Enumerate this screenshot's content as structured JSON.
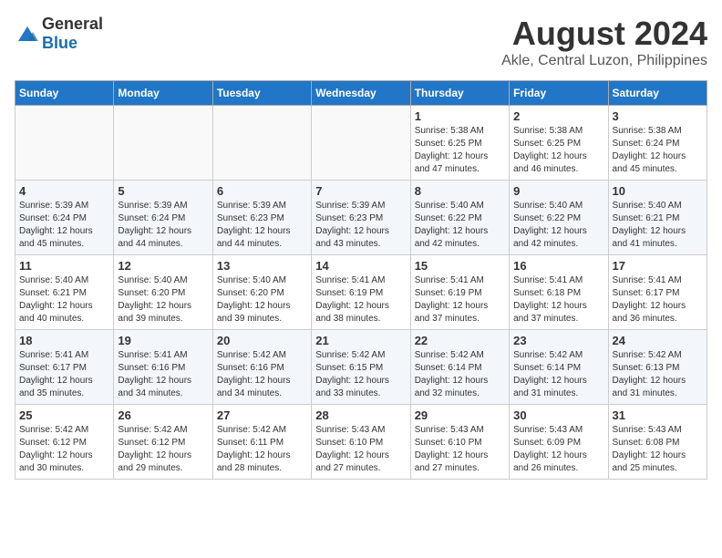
{
  "header": {
    "logo_general": "General",
    "logo_blue": "Blue",
    "month_year": "August 2024",
    "location": "Akle, Central Luzon, Philippines"
  },
  "days_of_week": [
    "Sunday",
    "Monday",
    "Tuesday",
    "Wednesday",
    "Thursday",
    "Friday",
    "Saturday"
  ],
  "weeks": [
    [
      {
        "day": "",
        "info": ""
      },
      {
        "day": "",
        "info": ""
      },
      {
        "day": "",
        "info": ""
      },
      {
        "day": "",
        "info": ""
      },
      {
        "day": "1",
        "info": "Sunrise: 5:38 AM\nSunset: 6:25 PM\nDaylight: 12 hours\nand 47 minutes."
      },
      {
        "day": "2",
        "info": "Sunrise: 5:38 AM\nSunset: 6:25 PM\nDaylight: 12 hours\nand 46 minutes."
      },
      {
        "day": "3",
        "info": "Sunrise: 5:38 AM\nSunset: 6:24 PM\nDaylight: 12 hours\nand 45 minutes."
      }
    ],
    [
      {
        "day": "4",
        "info": "Sunrise: 5:39 AM\nSunset: 6:24 PM\nDaylight: 12 hours\nand 45 minutes."
      },
      {
        "day": "5",
        "info": "Sunrise: 5:39 AM\nSunset: 6:24 PM\nDaylight: 12 hours\nand 44 minutes."
      },
      {
        "day": "6",
        "info": "Sunrise: 5:39 AM\nSunset: 6:23 PM\nDaylight: 12 hours\nand 44 minutes."
      },
      {
        "day": "7",
        "info": "Sunrise: 5:39 AM\nSunset: 6:23 PM\nDaylight: 12 hours\nand 43 minutes."
      },
      {
        "day": "8",
        "info": "Sunrise: 5:40 AM\nSunset: 6:22 PM\nDaylight: 12 hours\nand 42 minutes."
      },
      {
        "day": "9",
        "info": "Sunrise: 5:40 AM\nSunset: 6:22 PM\nDaylight: 12 hours\nand 42 minutes."
      },
      {
        "day": "10",
        "info": "Sunrise: 5:40 AM\nSunset: 6:21 PM\nDaylight: 12 hours\nand 41 minutes."
      }
    ],
    [
      {
        "day": "11",
        "info": "Sunrise: 5:40 AM\nSunset: 6:21 PM\nDaylight: 12 hours\nand 40 minutes."
      },
      {
        "day": "12",
        "info": "Sunrise: 5:40 AM\nSunset: 6:20 PM\nDaylight: 12 hours\nand 39 minutes."
      },
      {
        "day": "13",
        "info": "Sunrise: 5:40 AM\nSunset: 6:20 PM\nDaylight: 12 hours\nand 39 minutes."
      },
      {
        "day": "14",
        "info": "Sunrise: 5:41 AM\nSunset: 6:19 PM\nDaylight: 12 hours\nand 38 minutes."
      },
      {
        "day": "15",
        "info": "Sunrise: 5:41 AM\nSunset: 6:19 PM\nDaylight: 12 hours\nand 37 minutes."
      },
      {
        "day": "16",
        "info": "Sunrise: 5:41 AM\nSunset: 6:18 PM\nDaylight: 12 hours\nand 37 minutes."
      },
      {
        "day": "17",
        "info": "Sunrise: 5:41 AM\nSunset: 6:17 PM\nDaylight: 12 hours\nand 36 minutes."
      }
    ],
    [
      {
        "day": "18",
        "info": "Sunrise: 5:41 AM\nSunset: 6:17 PM\nDaylight: 12 hours\nand 35 minutes."
      },
      {
        "day": "19",
        "info": "Sunrise: 5:41 AM\nSunset: 6:16 PM\nDaylight: 12 hours\nand 34 minutes."
      },
      {
        "day": "20",
        "info": "Sunrise: 5:42 AM\nSunset: 6:16 PM\nDaylight: 12 hours\nand 34 minutes."
      },
      {
        "day": "21",
        "info": "Sunrise: 5:42 AM\nSunset: 6:15 PM\nDaylight: 12 hours\nand 33 minutes."
      },
      {
        "day": "22",
        "info": "Sunrise: 5:42 AM\nSunset: 6:14 PM\nDaylight: 12 hours\nand 32 minutes."
      },
      {
        "day": "23",
        "info": "Sunrise: 5:42 AM\nSunset: 6:14 PM\nDaylight: 12 hours\nand 31 minutes."
      },
      {
        "day": "24",
        "info": "Sunrise: 5:42 AM\nSunset: 6:13 PM\nDaylight: 12 hours\nand 31 minutes."
      }
    ],
    [
      {
        "day": "25",
        "info": "Sunrise: 5:42 AM\nSunset: 6:12 PM\nDaylight: 12 hours\nand 30 minutes."
      },
      {
        "day": "26",
        "info": "Sunrise: 5:42 AM\nSunset: 6:12 PM\nDaylight: 12 hours\nand 29 minutes."
      },
      {
        "day": "27",
        "info": "Sunrise: 5:42 AM\nSunset: 6:11 PM\nDaylight: 12 hours\nand 28 minutes."
      },
      {
        "day": "28",
        "info": "Sunrise: 5:43 AM\nSunset: 6:10 PM\nDaylight: 12 hours\nand 27 minutes."
      },
      {
        "day": "29",
        "info": "Sunrise: 5:43 AM\nSunset: 6:10 PM\nDaylight: 12 hours\nand 27 minutes."
      },
      {
        "day": "30",
        "info": "Sunrise: 5:43 AM\nSunset: 6:09 PM\nDaylight: 12 hours\nand 26 minutes."
      },
      {
        "day": "31",
        "info": "Sunrise: 5:43 AM\nSunset: 6:08 PM\nDaylight: 12 hours\nand 25 minutes."
      }
    ]
  ]
}
